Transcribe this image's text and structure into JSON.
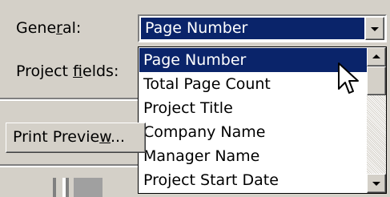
{
  "labels": {
    "general_pre": "Gene",
    "general_mnemonic": "r",
    "general_post": "al:",
    "project_fields_pre": "Project ",
    "project_fields_mnemonic": "f",
    "project_fields_post": "ields:"
  },
  "combo": {
    "selected": "Page Number"
  },
  "dropdown": {
    "items": [
      "Page Number",
      "Total Page Count",
      "Project Title",
      "Company Name",
      "Manager Name",
      "Project Start Date"
    ],
    "selected_index": 0
  },
  "print_preview": {
    "pre": "Print Previe",
    "mnemonic": "w",
    "post": "..."
  },
  "icons": {
    "combo_arrow": "chevron-down-icon",
    "scroll_up": "scroll-up-icon",
    "scroll_down": "scroll-down-icon",
    "cursor": "mouse-pointer-icon"
  },
  "colors": {
    "face": "#d4d0c8",
    "highlight": "#0a246a"
  }
}
